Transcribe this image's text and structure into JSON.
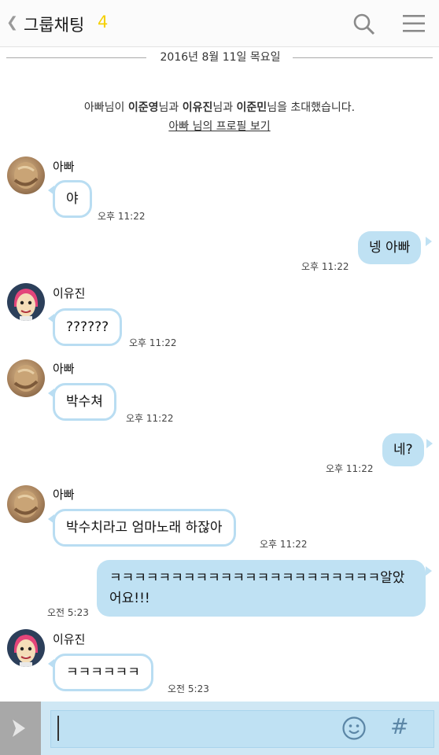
{
  "header": {
    "back_icon": "chevron-left-icon",
    "title": "그룹채팅",
    "member_count": "4",
    "search_icon": "search-icon",
    "menu_icon": "menu-icon"
  },
  "date_divider": "2016년 8월 11일 목요일",
  "notice": {
    "inviter": "아빠",
    "t1": "님이 ",
    "invitee1": "이준영",
    "t2": "님과 ",
    "invitee2": "이유진",
    "t3": "님과 ",
    "invitee3": "이준민",
    "t4": "님을 초대했습니다.",
    "profile_link": "아빠 님의 프로필 보기"
  },
  "messages": [
    {
      "sender": "아빠",
      "text": "야",
      "time": "오후 11:22"
    },
    {
      "sender": "me",
      "text": "넹 아빠",
      "time": "오후 11:22"
    },
    {
      "sender": "이유진",
      "text": "??????",
      "time": "오후 11:22"
    },
    {
      "sender": "아빠",
      "text": "박수쳐",
      "time": "오후 11:22"
    },
    {
      "sender": "me",
      "text": "네?",
      "time": "오후 11:22"
    },
    {
      "sender": "아빠",
      "text": "박수치라고 엄마노래 하잖아",
      "time": "오후 11:22"
    },
    {
      "sender": "me",
      "text": "ㅋㅋㅋㅋㅋㅋㅋㅋㅋㅋㅋㅋㅋㅋㅋㅋㅋㅋㅋㅋㅋㅋ알았어요!!!",
      "time": "오전 5:23"
    },
    {
      "sender": "이유진",
      "text": "ㅋㅋㅋㅋㅋㅋ",
      "time": "오전 5:23"
    }
  ],
  "input_bar": {
    "toggle_icon": "chevron-right-icon",
    "emoji_icon": "smiley-icon",
    "hash_label": "#"
  },
  "colors": {
    "accent_yellow": "#f5d000",
    "outgoing_bubble": "#bfe1f3",
    "incoming_border": "#b9ddf2"
  }
}
